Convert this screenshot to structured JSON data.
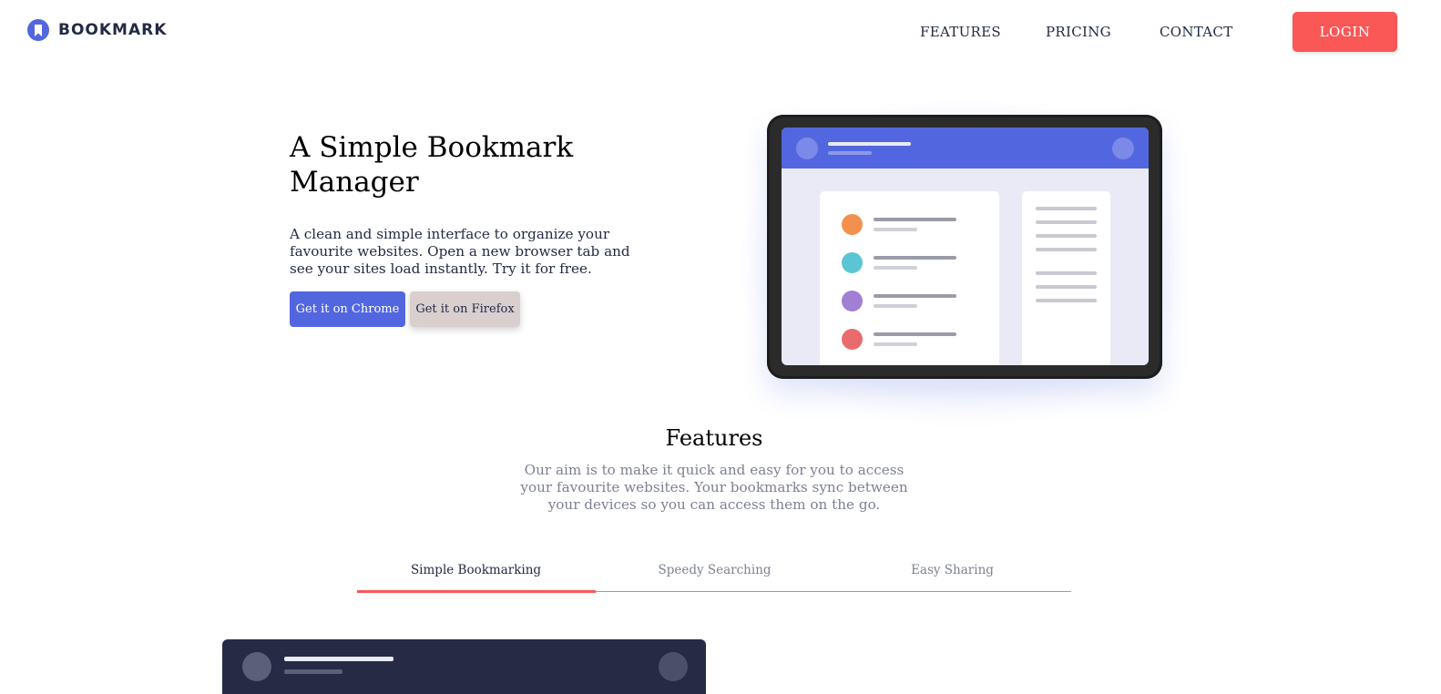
{
  "header": {
    "logo_text": "BOOKMARK",
    "nav": [
      "FEATURES",
      "PRICING",
      "CONTACT"
    ],
    "login_label": "LOGIN"
  },
  "hero": {
    "title": "A Simple Bookmark Manager",
    "description": "A clean and simple interface to organize your favourite websites. Open a new browser tab and see your sites load instantly. Try it for free.",
    "chrome_button": "Get it on Chrome",
    "firefox_button": "Get it on Firefox"
  },
  "features": {
    "title": "Features",
    "description": "Our aim is to make it quick and easy for you to access your favourite websites. Your bookmarks sync between your devices so you can access them on the go.",
    "tabs": [
      "Simple Bookmarking",
      "Speedy Searching",
      "Easy Sharing"
    ],
    "active_tab": "Simple Bookmarking"
  },
  "colors": {
    "primary": "#5267DF",
    "accent": "#FA5757",
    "dark": "#242A45",
    "muted": "#7d8092",
    "bookmark_dots": [
      "#F4904D",
      "#5CC5D3",
      "#A07FD4",
      "#E96B6E"
    ]
  },
  "icons": {
    "logo": "bookmark-icon"
  }
}
